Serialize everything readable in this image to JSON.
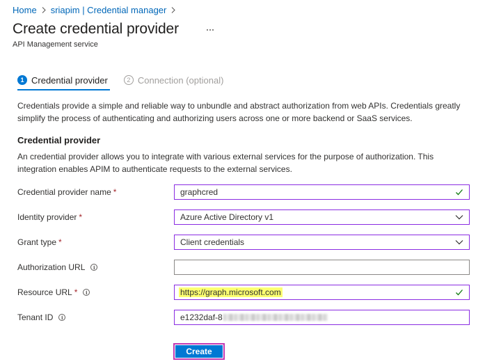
{
  "breadcrumb": {
    "items": [
      "Home",
      "sriapim | Credential manager"
    ]
  },
  "header": {
    "title": "Create credential provider",
    "subtitle": "API Management service"
  },
  "tabs": [
    {
      "number": "1",
      "label": "Credential provider",
      "active": true
    },
    {
      "number": "2",
      "label": "Connection (optional)",
      "active": false
    }
  ],
  "intro": "Credentials provide a simple and reliable way to unbundle and abstract authorization from web APIs. Credentials greatly simplify the process of authenticating and authorizing users across one or more backend or SaaS services.",
  "section": {
    "title": "Credential provider",
    "description": "An credential provider allows you to integrate with various external services for the purpose of authorization. This integration enables APIM to authenticate requests to the external services."
  },
  "form": {
    "provider_name": {
      "label": "Credential provider name",
      "required_mark": "*",
      "value": "graphcred"
    },
    "identity_provider": {
      "label": "Identity provider",
      "required_mark": "*",
      "value": "Azure Active Directory v1"
    },
    "grant_type": {
      "label": "Grant type",
      "required_mark": "*",
      "value": "Client credentials"
    },
    "authorization_url": {
      "label": "Authorization URL",
      "value": ""
    },
    "resource_url": {
      "label": "Resource URL",
      "required_mark": "*",
      "value": "https://graph.microsoft.com"
    },
    "tenant_id": {
      "label": "Tenant ID",
      "value": "e1232daf-8"
    }
  },
  "actions": {
    "create_label": "Create"
  },
  "colors": {
    "accent": "#0078d4",
    "focus_border": "#8a2be2",
    "check": "#107c10",
    "required": "#a4262c",
    "highlight": "#fcff71",
    "create_outline": "#c239b3"
  },
  "icons": {
    "separator": "chevron-right-icon",
    "more": "more-icon",
    "info": "info-icon",
    "valid": "checkmark-icon",
    "dropdown": "chevron-down-icon"
  }
}
